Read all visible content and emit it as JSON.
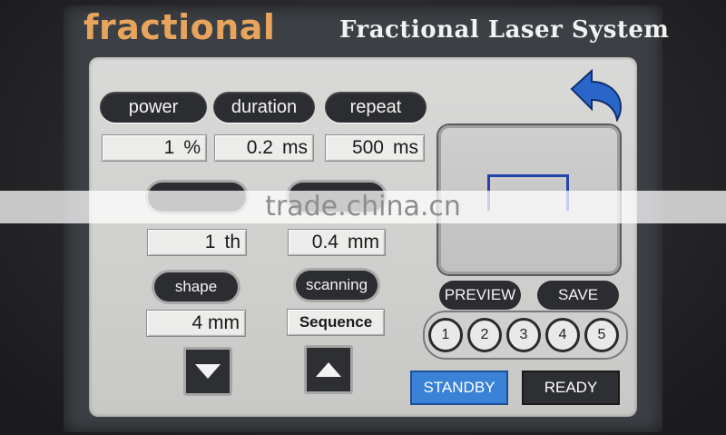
{
  "header": {
    "brand": "fractional",
    "title": "Fractional Laser System"
  },
  "params": {
    "power": {
      "label": "power",
      "value": "1",
      "unit": "%"
    },
    "duration": {
      "label": "duration",
      "value": "0.2",
      "unit": "ms"
    },
    "repeat": {
      "label": "repeat",
      "value": "500",
      "unit": "ms"
    },
    "count": {
      "value": "1",
      "unit": "th"
    },
    "distance": {
      "value": "0.4",
      "unit": "mm"
    },
    "shape": {
      "label": "shape",
      "value": "4 mm"
    },
    "scanning": {
      "label": "scanning",
      "value": "Sequence"
    }
  },
  "actions": {
    "preview": "PREVIEW",
    "save": "SAVE",
    "standby": "STANDBY",
    "ready": "READY"
  },
  "slots": [
    "1",
    "2",
    "3",
    "4",
    "5"
  ],
  "watermark": "trade.china.cn",
  "colors": {
    "brand": "#e7a45c",
    "back_arrow": "#2a66c9",
    "standby": "#3a82d6",
    "ready": "#2d2f33",
    "shape_outline": "#2244aa"
  },
  "icons": {
    "back": "back-arrow-icon",
    "decrease": "triangle-down-icon",
    "increase": "triangle-up-icon"
  }
}
